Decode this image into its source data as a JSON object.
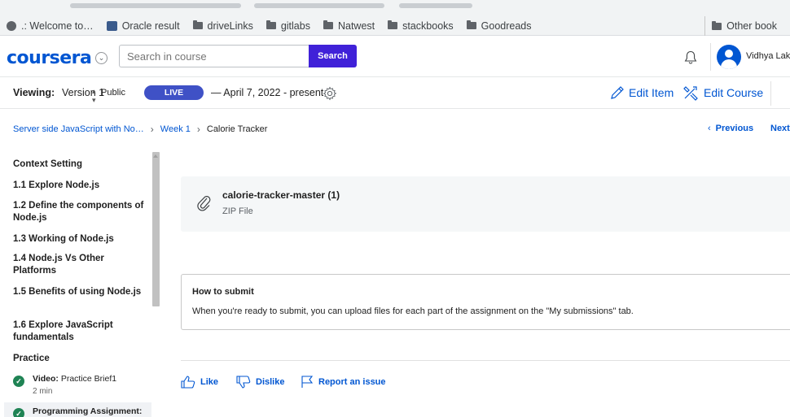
{
  "bookmarks": {
    "items": [
      {
        "icon": "globe-icon",
        "label": ".: Welcome to…"
      },
      {
        "icon": "oracle-icon",
        "label": "Oracle result"
      },
      {
        "icon": "folder-icon",
        "label": "driveLinks"
      },
      {
        "icon": "folder-icon",
        "label": "gitlabs"
      },
      {
        "icon": "folder-icon",
        "label": "Natwest"
      },
      {
        "icon": "folder-icon",
        "label": "stackbooks"
      },
      {
        "icon": "folder-icon",
        "label": "Goodreads"
      }
    ],
    "other": "Other book"
  },
  "header": {
    "logo": "coursera",
    "search_placeholder": "Search in course",
    "search_button": "Search",
    "user_name": "Vidhya Laks"
  },
  "version_bar": {
    "viewing_label": "Viewing:",
    "version": "Version 1",
    "visibility": "Public",
    "status": "LIVE",
    "date_range": "— April 7, 2022 - present",
    "edit_item": "Edit Item",
    "edit_course": "Edit Course"
  },
  "breadcrumb": {
    "course": "Server side JavaScript with No…",
    "week": "Week 1",
    "current": "Calorie Tracker",
    "previous": "Previous",
    "next": "Next"
  },
  "sidebar": {
    "items": [
      {
        "label": "Context Setting"
      },
      {
        "label": "1.1 Explore Node.js"
      },
      {
        "label": "1.2 Define the components of Node.js"
      },
      {
        "label": "1.3 Working of Node.js"
      },
      {
        "label": "1.4 Node.js Vs Other Platforms"
      },
      {
        "label": "1.5 Benefits of using Node.js"
      },
      {
        "label": "1.6 Explore JavaScript fundamentals"
      },
      {
        "label": "Practice"
      }
    ],
    "sub_items": [
      {
        "type_label": "Video:",
        "title": "Practice Brief1",
        "meta": "2 min"
      },
      {
        "type_label": "Programming Assignment:",
        "title": "",
        "meta": ""
      }
    ]
  },
  "main": {
    "file": {
      "name": "calorie-tracker-master (1)",
      "type": "ZIP File"
    },
    "submit": {
      "title": "How to submit",
      "text": "When you're ready to submit, you can upload files for each part of the assignment on the \"My submissions\" tab."
    },
    "actions": {
      "like": "Like",
      "dislike": "Dislike",
      "report": "Report an issue"
    }
  },
  "colors": {
    "brand": "#0056d2",
    "accent": "#4021d8",
    "live": "#3f51c6",
    "check": "#1f8354"
  }
}
